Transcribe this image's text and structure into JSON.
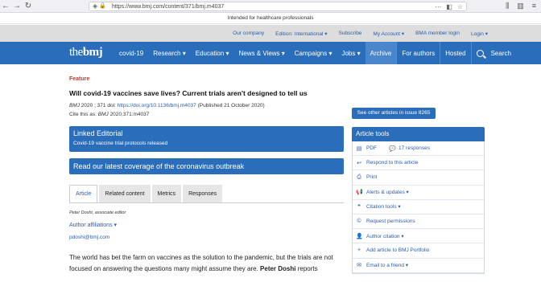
{
  "browser": {
    "url": "https://www.bmj.com/content/371/bmj.m4037"
  },
  "banner": "Intended for healthcare professionals",
  "utility": {
    "links": [
      "Our company",
      "Edition: International ▾",
      "Subscribe",
      "My Account ▾",
      "BMA member login",
      "Login ▾"
    ]
  },
  "nav": {
    "logo_the": "the",
    "logo_bmj": "bmj",
    "items": [
      "covid-19",
      "Research ▾",
      "Education ▾",
      "News & Views ▾",
      "Campaigns ▾",
      "Jobs ▾",
      "Archive",
      "For authors",
      "Hosted"
    ],
    "search": "Search"
  },
  "article": {
    "section": "Feature",
    "title": "Will covid-19 vaccines save lives? Current trials aren't designed to tell us",
    "journal": "BMJ",
    "cite_vol": " 2020 ; 371  doi: ",
    "doi": "https://doi.org/10.1136/bmj.m4037",
    "published": " (Published 21 October 2020)",
    "cite_as_label": "Cite this as: ",
    "cite_as_journal": "BMJ",
    "cite_as_value": " 2020;371:m4037",
    "linked_title": "Linked Editorial",
    "linked_sub": "Covid-19 vaccine trial protocols released",
    "coverage": "Read our latest coverage of the coronavirus outbreak",
    "tabs": [
      "Article",
      "Related content",
      "Metrics",
      "Responses"
    ],
    "author": "Peter Doshi, associate editor",
    "affiliations": "Author affiliations ▾",
    "email": "pdoshi@bmj.com",
    "body_1": "The world has bet the farm on vaccines as the solution to the pandemic, but the trials are not focused on answering the questions many might assume they are. ",
    "body_author": "Peter Doshi",
    "body_2": " reports"
  },
  "sidebar": {
    "see_other": "See other articles in issue 8265",
    "tools_title": "Article tools",
    "pdf": "PDF",
    "responses": "17 responses",
    "tools": [
      "Respond to this article",
      "Print",
      "Alerts & updates ▾",
      "Citation tools ▾",
      "Request permissions",
      "Author citation ▾",
      "Add article to BMJ Portfolio",
      "Email to a friend ▾"
    ],
    "tool_icons": [
      "reply-icon",
      "print-icon",
      "megaphone-icon",
      "quote-icon",
      "copyright-icon",
      "user-icon",
      "plus-icon",
      "mail-icon"
    ]
  }
}
